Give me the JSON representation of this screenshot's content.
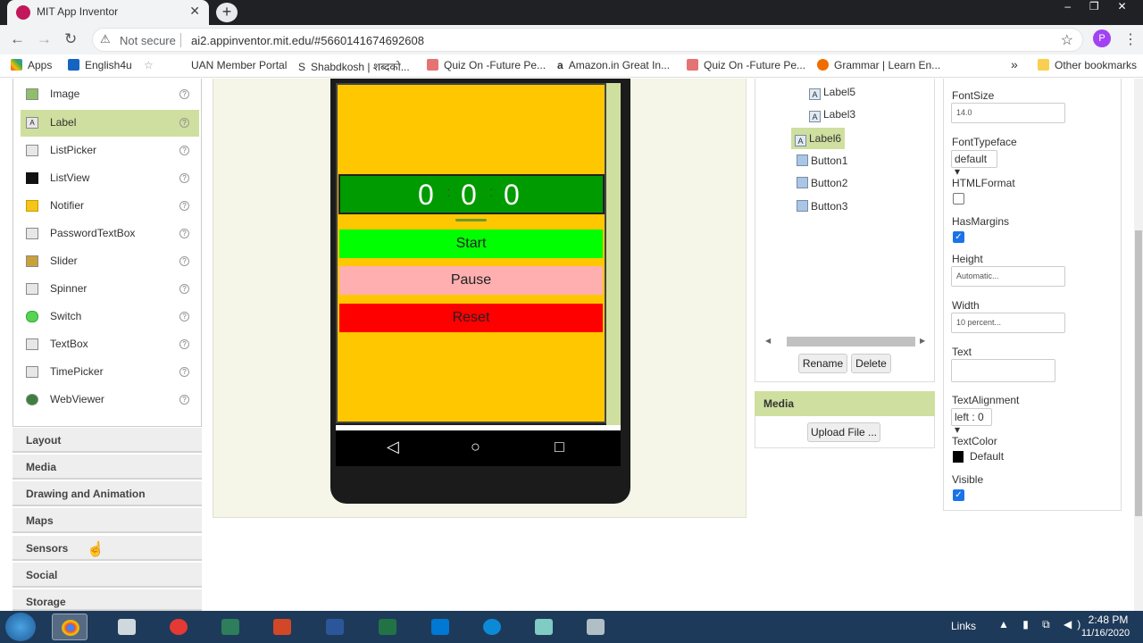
{
  "browser": {
    "tab_title": "MIT App Inventor",
    "new_tab": "+",
    "security_label": "Not secure",
    "url": "ai2.appinventor.mit.edu/#5660141674692608",
    "profile_initial": "P",
    "bookmarks": [
      "Apps",
      "English4u",
      "UAN Member Portal",
      "Shabdkosh | शब्दको...",
      "Quiz On -Future Pe...",
      "Amazon.in Great In...",
      "Quiz On -Future Pe...",
      "Grammar | Learn En..."
    ],
    "other_bookmarks": "Other bookmarks",
    "overflow": "»"
  },
  "palette": {
    "items": [
      {
        "label": "Image",
        "icon": "image-icon"
      },
      {
        "label": "Label",
        "icon": "label-icon",
        "selected": true
      },
      {
        "label": "ListPicker",
        "icon": "listpicker-icon"
      },
      {
        "label": "ListView",
        "icon": "listview-icon"
      },
      {
        "label": "Notifier",
        "icon": "notifier-icon"
      },
      {
        "label": "PasswordTextBox",
        "icon": "password-icon"
      },
      {
        "label": "Slider",
        "icon": "slider-icon"
      },
      {
        "label": "Spinner",
        "icon": "spinner-icon"
      },
      {
        "label": "Switch",
        "icon": "switch-icon"
      },
      {
        "label": "TextBox",
        "icon": "textbox-icon"
      },
      {
        "label": "TimePicker",
        "icon": "timepicker-icon"
      },
      {
        "label": "WebViewer",
        "icon": "webviewer-icon"
      }
    ],
    "help": "?",
    "drawers": [
      "Layout",
      "Media",
      "Drawing and Animation",
      "Maps",
      "Sensors",
      "Social",
      "Storage"
    ]
  },
  "viewer": {
    "timer": {
      "h": "0",
      "m": "0",
      "s": "0",
      "sep": ":"
    },
    "buttons": [
      {
        "label": "Start",
        "color": "#00ff00"
      },
      {
        "label": "Pause",
        "color": "#ffafaf"
      },
      {
        "label": "Reset",
        "color": "#ff0000"
      }
    ],
    "screen_color": "#ffc700",
    "bar_color": "#009b00",
    "nav": {
      "back": "◁",
      "home": "○",
      "recent": "□"
    }
  },
  "components": {
    "tree": [
      {
        "label": "Label5",
        "icon": "A"
      },
      {
        "label": "Label3",
        "icon": "A"
      },
      {
        "label": "Label6",
        "icon": "A",
        "selected": true
      },
      {
        "label": "Button1",
        "icon": ""
      },
      {
        "label": "Button2",
        "icon": ""
      },
      {
        "label": "Button3",
        "icon": ""
      }
    ],
    "scroll_left": "◀",
    "scroll_right": "▶",
    "rename": "Rename",
    "delete": "Delete"
  },
  "media": {
    "header": "Media",
    "upload": "Upload File ..."
  },
  "properties": {
    "fontsize_label": "FontSize",
    "fontsize_value": "14.0",
    "fonttypeface_label": "FontTypeface",
    "fonttypeface_value": "default ▾",
    "htmlformat_label": "HTMLFormat",
    "hasmargins_label": "HasMargins",
    "height_label": "Height",
    "height_value": "Automatic...",
    "width_label": "Width",
    "width_value": "10 percent...",
    "text_label": "Text",
    "textalignment_label": "TextAlignment",
    "textalignment_value": "left : 0 ▾",
    "textcolor_label": "TextColor",
    "textcolor_value": "Default",
    "visible_label": "Visible",
    "check": "✓"
  },
  "taskbar": {
    "links": "Links",
    "time": "2:48 PM",
    "date": "11/16/2020"
  }
}
